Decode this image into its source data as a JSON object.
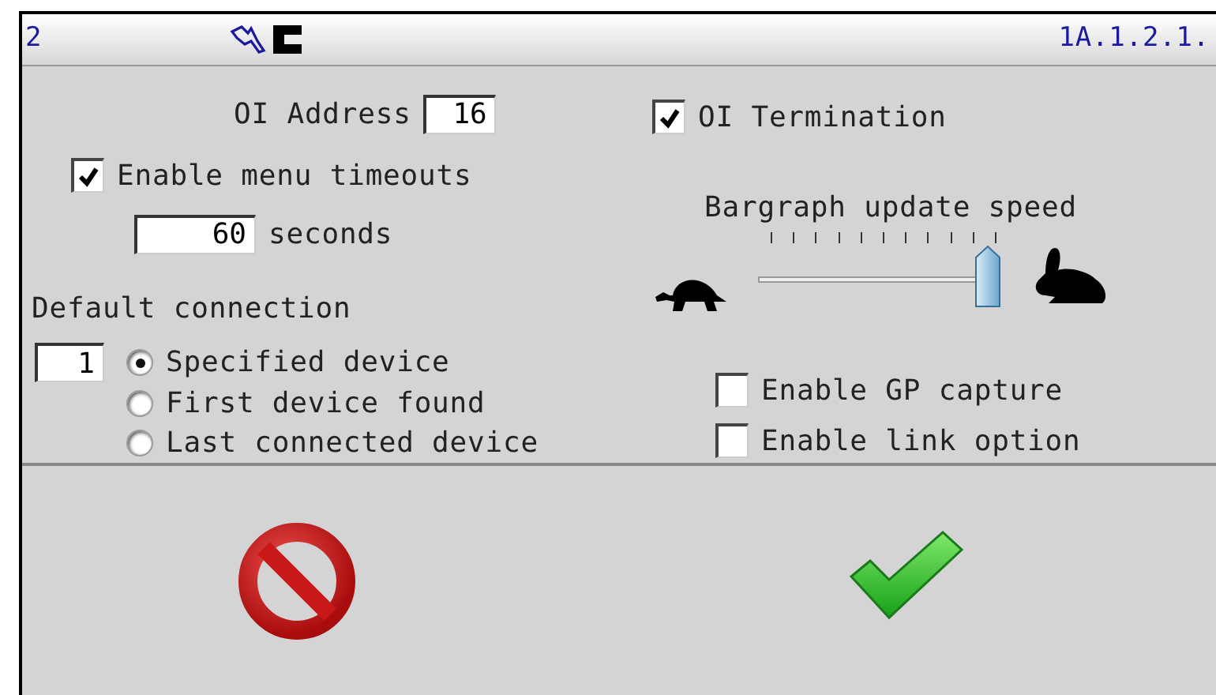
{
  "title_bar": {
    "left_text": "2",
    "right_text": "1A.1.2.1."
  },
  "oi_address": {
    "label": "OI Address",
    "value": "16"
  },
  "menu_timeouts": {
    "label": "Enable menu timeouts",
    "checked": true,
    "value": "60",
    "unit": "seconds"
  },
  "default_connection": {
    "label": "Default connection",
    "device_number": "1",
    "options": [
      {
        "label": "Specified device",
        "selected": true
      },
      {
        "label": "First device found",
        "selected": false
      },
      {
        "label": "Last connected device",
        "selected": false
      }
    ]
  },
  "oi_termination": {
    "label": "OI Termination",
    "checked": true
  },
  "bargraph": {
    "label": "Bargraph update speed",
    "level": 1.0
  },
  "options": [
    {
      "label": "Enable GP capture",
      "checked": false
    },
    {
      "label": "Enable link option",
      "checked": false
    }
  ],
  "buttons": [
    {
      "kind": "cancel"
    },
    {
      "kind": "ok"
    }
  ]
}
